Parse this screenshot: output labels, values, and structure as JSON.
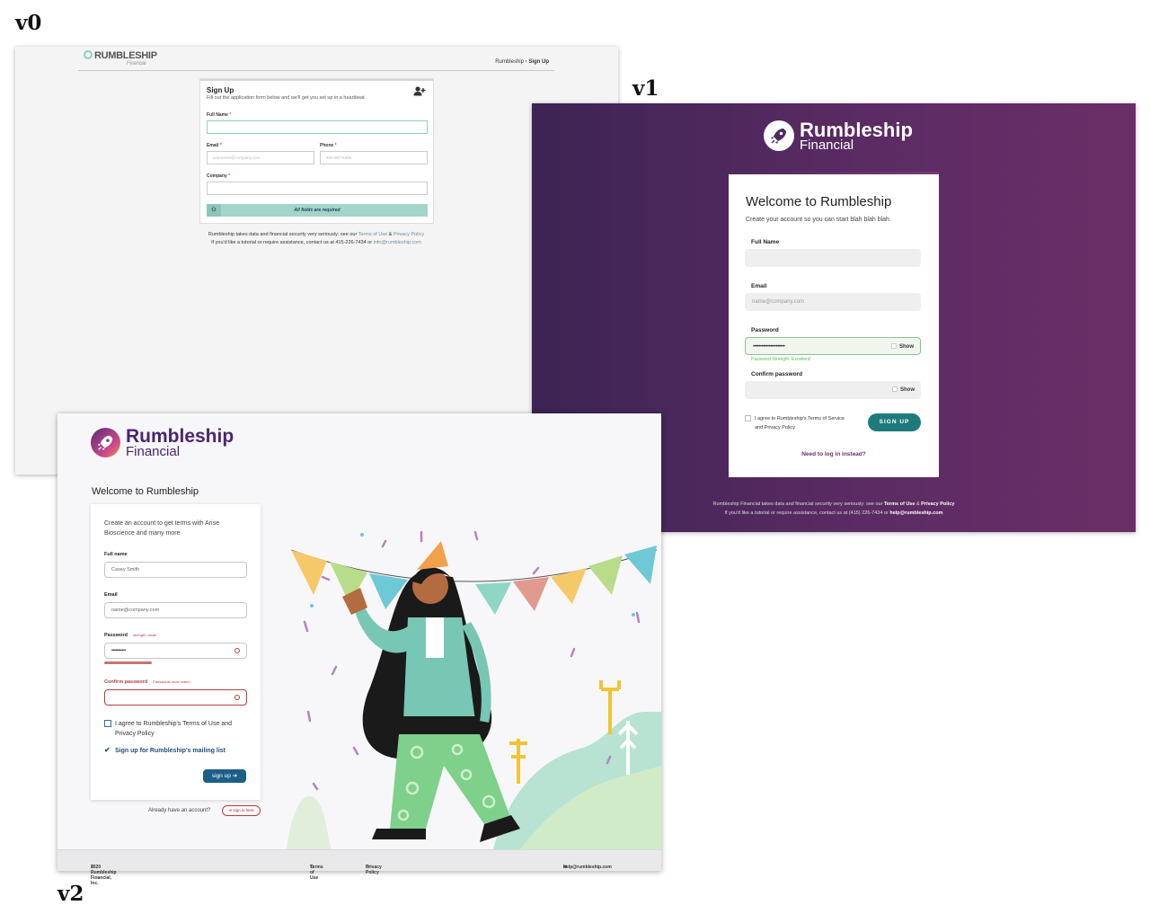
{
  "labels": {
    "v0": "v0",
    "v1": "v1",
    "v2": "v2"
  },
  "v0": {
    "logo": "RUMBLESHIP",
    "logo_sub": "Financial",
    "breadcrumb_root": "Rumbleship",
    "breadcrumb_sep": "›",
    "breadcrumb_current": "Sign Up",
    "title": "Sign Up",
    "subtitle": "Fill out the application form below and we'll get you set up in a heartbeat",
    "icon": "add-user-icon",
    "fields": {
      "full_name": {
        "label": "Full Name",
        "value": ""
      },
      "email": {
        "label": "Email",
        "placeholder": "username@company.com"
      },
      "phone": {
        "label": "Phone",
        "placeholder": "800-867-5309"
      },
      "company": {
        "label": "Company",
        "value": ""
      }
    },
    "required_mark": "*",
    "button": "All fields are required",
    "footer_line1_text": "Rumbleship takes data and financial security very seriously: see our ",
    "footer_terms": "Terms of Use",
    "footer_and": " & ",
    "footer_privacy": "Privacy Policy",
    "footer_line2_text": "If you'd like a tutorial or require assistance, contact us at 415-226-7434 or ",
    "footer_email": "info@rumbleship.com"
  },
  "v1": {
    "brand_name": "Rumbleship",
    "brand_sub": "Financial",
    "title": "Welcome to Rumbleship",
    "subtitle": "Create your account so you can start blah blah blah.",
    "full_name_label": "Full Name",
    "email_label": "Email",
    "email_placeholder": "name@company.com",
    "password_label": "Password",
    "password_value": "••••••••••••••••••••••",
    "show": "Show",
    "strength": "Password Strength: Excellent!",
    "confirm_label": "Confirm password",
    "agree": "I agree to Rumbleship's Terms of Service and Privacy Policy",
    "button": "SIGN UP",
    "login_link": "Need to log in instead?",
    "footer_line1_text": "Rumbleship Financial takes data and financial security very seriously: see our ",
    "footer_terms": "Terms of Use",
    "footer_and": " & ",
    "footer_privacy": "Privacy Policy",
    "footer_line2_text": "If you'd like a tutorial or require assistance, contact us at (415) 226-7434 or ",
    "footer_email": "help@rumbleship.com",
    "colors": {
      "bg_start": "#3c2453",
      "bg_end": "#6b2e67",
      "button": "#1f7b7b"
    }
  },
  "v2": {
    "brand_name": "Rumbleship",
    "brand_sub": "Financial",
    "welcome": "Welcome to Rumbleship",
    "intro": "Create an account to get terms with Arise Bioscience and many more",
    "full_name_label": "Full name",
    "full_name_value": "Casey Smith",
    "email_label": "Email",
    "email_placeholder": "name@company.com",
    "password_label": "Password",
    "password_hint": "strength: weak",
    "password_value": "•••••••••••",
    "confirm_label": "Confirm password",
    "confirm_hint": "Passwords must match",
    "agree": "I agree to Rumbleship's Terms of Use and Privacy Policy",
    "mailing": "Sign up for Rumbleship's mailing list",
    "button": "sign up",
    "already": "Already have an account?",
    "signin": "sign in here",
    "footer_copyright": "2020 Rumbleship Financial, Inc.",
    "footer_terms": "Terms of Use",
    "footer_privacy": "Privacy Policy",
    "footer_email": "help@rumbleship.com",
    "colors": {
      "brand": "#4b2570",
      "error": "#b0413e",
      "button": "#1d5f86"
    }
  }
}
